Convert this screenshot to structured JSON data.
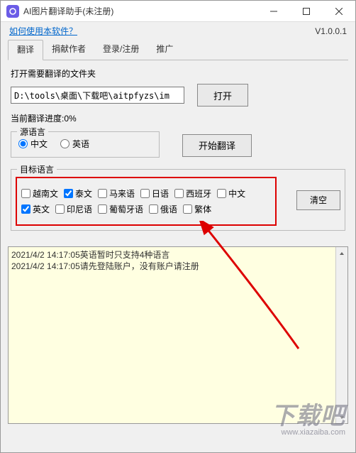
{
  "window": {
    "title": "AI图片翻译助手(未注册)"
  },
  "header": {
    "help_link": "如何使用本软件？",
    "version": "V1.0.0.1"
  },
  "tabs": {
    "translate": "翻译",
    "donate": "捐献作者",
    "login": "登录/注册",
    "promote": "推广"
  },
  "main": {
    "open_folder_label": "打开需要翻译的文件夹",
    "path_value": "D:\\tools\\桌面\\下载吧\\aitpfyzs\\im",
    "open_btn": "打开",
    "progress_label": "当前翻译进度:",
    "progress_value": "0%"
  },
  "source": {
    "legend": "源语言",
    "chinese": "中文",
    "english": "英语",
    "start_btn": "开始翻译"
  },
  "target": {
    "legend": "目标语言",
    "vn": "越南文",
    "thai": "泰文",
    "malay": "马来语",
    "jp": "日语",
    "spanish": "西班牙",
    "zh": "中文",
    "en": "英文",
    "indo": "印尼语",
    "pt": "葡萄牙语",
    "ru": "俄语",
    "trad": "繁体",
    "clear_btn": "清空"
  },
  "log": {
    "line1": "2021/4/2 14:17:05英语暂时只支持4种语言",
    "line2": "2021/4/2 14:17:05请先登陆账户，没有账户请注册"
  },
  "watermark": {
    "text": "下载吧",
    "url": "www.xiazaiba.com"
  }
}
